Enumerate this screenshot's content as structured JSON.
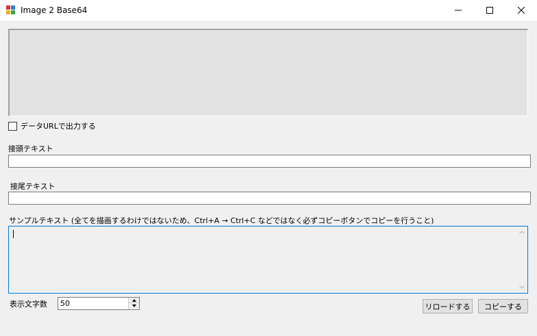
{
  "window": {
    "title": "Image 2 Base64",
    "controls": [
      "minimize-icon",
      "maximize-icon",
      "close-icon"
    ],
    "app_icon": "app-icon"
  },
  "checkbox": {
    "label": "データURLで出力する",
    "checked": false
  },
  "prefix": {
    "label": "接頭テキスト",
    "value": ""
  },
  "suffix": {
    "label": "接尾テキスト",
    "value": ""
  },
  "sample": {
    "label": "サンプルテキスト (全てを描画するわけではないため、Ctrl+A → Ctrl+C などではなく必ずコピーボタンでコピーを行うこと)",
    "value": ""
  },
  "char_count": {
    "label": "表示文字数",
    "value": "50"
  },
  "buttons": {
    "reload": "リロードする",
    "copy": "コピーする"
  },
  "colors": {
    "focus_border": "#0078d7",
    "image_area_bg": "#e3e3e3"
  }
}
